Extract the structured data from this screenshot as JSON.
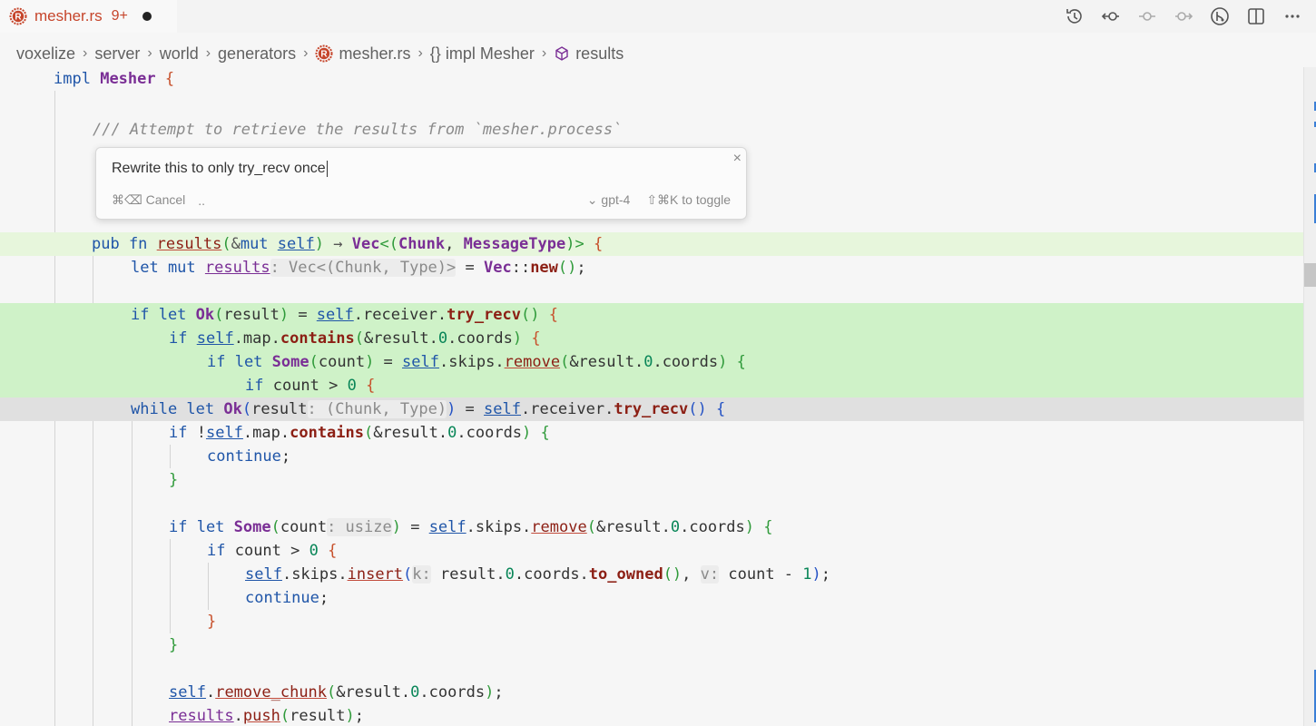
{
  "tab": {
    "title": "mesher.rs",
    "badge": "9+",
    "brand_color": "#c6452b"
  },
  "actions": [
    "history-icon",
    "go-back-icon",
    "git-commit-icon",
    "go-forward-icon",
    "git-merge-icon",
    "split-editor-icon",
    "more-icon"
  ],
  "breadcrumb": {
    "items": [
      "voxelize",
      "server",
      "world",
      "generators",
      "mesher.rs",
      "{} impl Mesher",
      "results"
    ]
  },
  "popup": {
    "input_value": "Rewrite this to only try_recv once",
    "cancel": "⌘⌫ Cancel",
    "dots": "..",
    "model": "gpt-4",
    "toggle": "⇧⌘K to toggle",
    "close": "×"
  },
  "code": {
    "comment": "/// Attempt to retrieve the results from `mesher.process`"
  }
}
